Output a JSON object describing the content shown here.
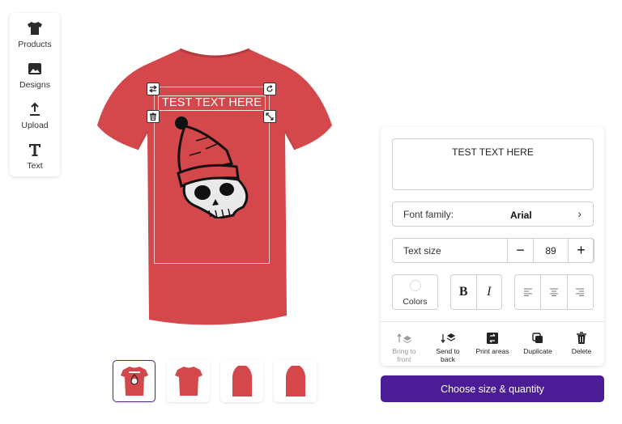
{
  "sidebar": {
    "items": [
      {
        "label": "Products",
        "icon": "tshirt-icon"
      },
      {
        "label": "Designs",
        "icon": "image-icon"
      },
      {
        "label": "Upload",
        "icon": "upload-icon"
      },
      {
        "label": "Text",
        "icon": "text-icon"
      }
    ]
  },
  "canvas": {
    "overlay_text": "TEST TEXT HERE",
    "shirt_color": "#d4474a"
  },
  "thumbnails": [
    {
      "view": "front-design",
      "selected": true
    },
    {
      "view": "front",
      "selected": false
    },
    {
      "view": "side-left",
      "selected": false
    },
    {
      "view": "side-right",
      "selected": false
    }
  ],
  "panel": {
    "text_value": "TEST TEXT HERE",
    "font_family_label": "Font family:",
    "font_family_value": "Arial",
    "text_size_label": "Text size",
    "text_size_value": "89",
    "minus": "−",
    "plus": "+",
    "colors_label": "Colors",
    "bold": "B",
    "italic": "I",
    "tools": [
      {
        "label_line1": "Bring to",
        "label_line2": "front",
        "disabled": true
      },
      {
        "label_line1": "Send to",
        "label_line2": "back",
        "disabled": false
      },
      {
        "label_line1": "Print areas",
        "label_line2": "",
        "disabled": false
      },
      {
        "label_line1": "Duplicate",
        "label_line2": "",
        "disabled": false
      },
      {
        "label_line1": "Delete",
        "label_line2": "",
        "disabled": false
      }
    ]
  },
  "cta": {
    "label": "Choose size & quantity",
    "color": "#4a1c96"
  }
}
